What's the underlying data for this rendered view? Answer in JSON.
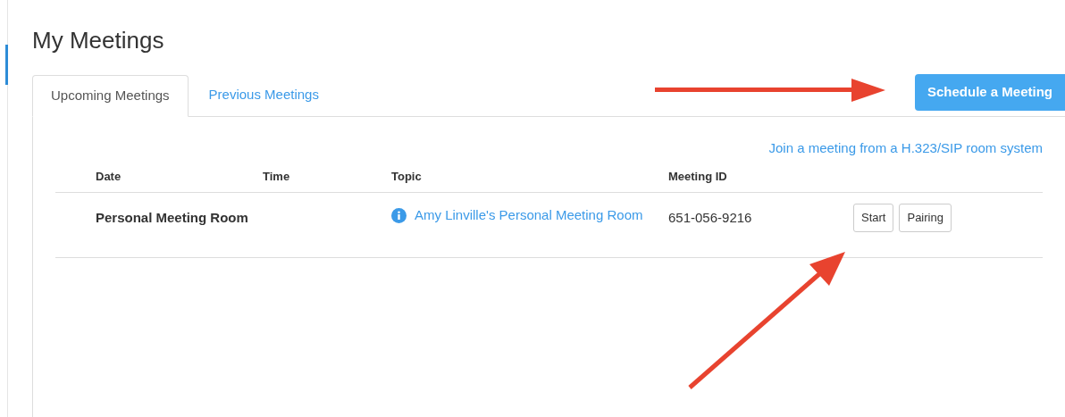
{
  "page_title": "My Meetings",
  "tabs": [
    {
      "label": "Upcoming Meetings",
      "selected": true
    },
    {
      "label": "Previous Meetings",
      "selected": false
    }
  ],
  "schedule_button": "Schedule a Meeting",
  "join_link": "Join a meeting from a H.323/SIP room system",
  "table": {
    "columns": [
      "Date",
      "Time",
      "Topic",
      "Meeting ID"
    ],
    "rows": [
      {
        "date": "Personal Meeting Room",
        "time": "",
        "topic": "Amy Linville's Personal Meeting Room",
        "meeting_id": "651-056-9216",
        "actions": [
          "Start",
          "Pairing"
        ]
      }
    ]
  }
}
